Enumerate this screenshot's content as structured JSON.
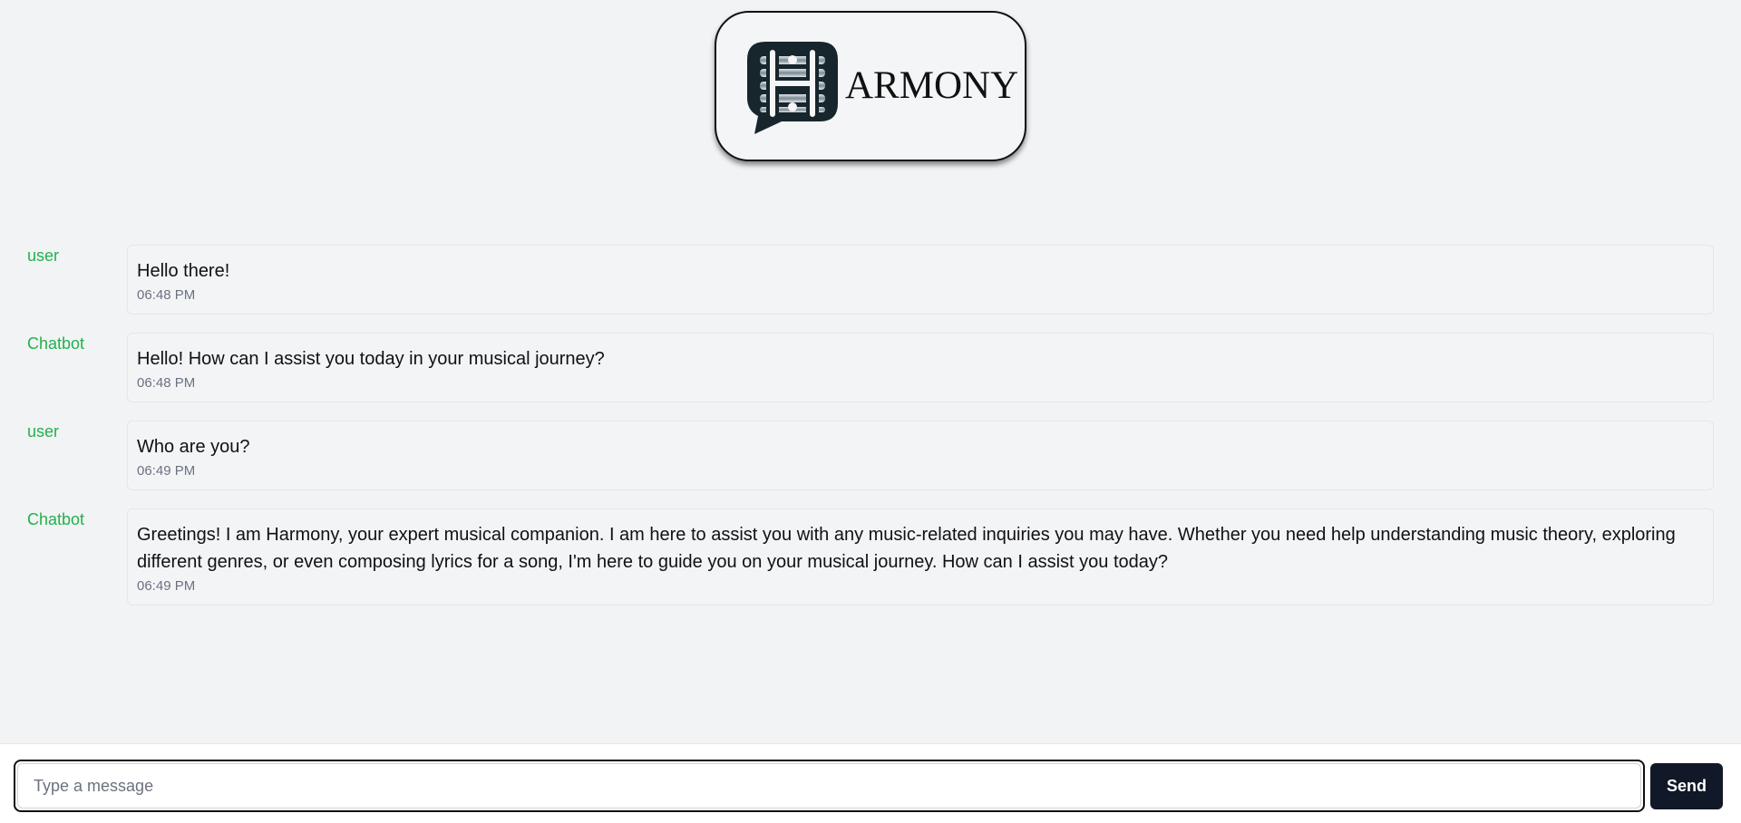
{
  "brand": {
    "logo_icon": "harmony-speech-bubble-h-icon",
    "logo_text": "ARMONY"
  },
  "messages": [
    {
      "sender": "user",
      "text": "Hello there!",
      "time": "06:48 PM"
    },
    {
      "sender": "Chatbot",
      "text": "Hello! How can I assist you today in your musical journey?",
      "time": "06:48 PM"
    },
    {
      "sender": "user",
      "text": "Who are you?",
      "time": "06:49 PM"
    },
    {
      "sender": "Chatbot",
      "text": "Greetings! I am Harmony, your expert musical companion. I am here to assist you with any music-related inquiries you may have. Whether you need help understanding music theory, exploring different genres, or even composing lyrics for a song, I'm here to guide you on your musical journey. How can I assist you today?",
      "time": "06:49 PM"
    }
  ],
  "composer": {
    "placeholder": "Type a message",
    "value": "",
    "send_label": "Send"
  },
  "colors": {
    "sender": "#22b14c",
    "send_button": "#111827",
    "background": "#f2f3f5"
  }
}
